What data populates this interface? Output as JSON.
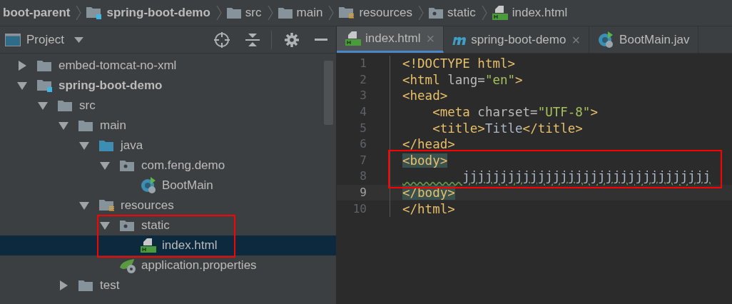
{
  "breadcrumbs": [
    {
      "label": "boot-parent",
      "kind": "plain",
      "bold": true
    },
    {
      "label": "spring-boot-demo",
      "kind": "module",
      "bold": true
    },
    {
      "label": "src",
      "kind": "folder",
      "bold": false
    },
    {
      "label": "main",
      "kind": "folder",
      "bold": false
    },
    {
      "label": "resources",
      "kind": "resources",
      "bold": false
    },
    {
      "label": "static",
      "kind": "package",
      "bold": false
    },
    {
      "label": "index.html",
      "kind": "html",
      "bold": false
    }
  ],
  "project_panel": {
    "title": "Project"
  },
  "tree": [
    {
      "label": "embed-tomcat-no-xml",
      "kind": "folder",
      "expanded": false,
      "selected": false,
      "bold": false
    },
    {
      "label": "spring-boot-demo",
      "kind": "module",
      "expanded": true,
      "selected": false,
      "bold": true,
      "children": [
        {
          "label": "src",
          "kind": "folder",
          "expanded": true,
          "selected": false,
          "bold": false,
          "children": [
            {
              "label": "main",
              "kind": "folder",
              "expanded": true,
              "selected": false,
              "bold": false,
              "children": [
                {
                  "label": "java",
                  "kind": "source",
                  "expanded": true,
                  "selected": false,
                  "bold": false,
                  "children": [
                    {
                      "label": "com.feng.demo",
                      "kind": "package",
                      "expanded": true,
                      "selected": false,
                      "bold": false,
                      "children": [
                        {
                          "label": "BootMain",
                          "kind": "boot",
                          "selected": false,
                          "bold": false
                        }
                      ]
                    }
                  ]
                },
                {
                  "label": "resources",
                  "kind": "resources",
                  "expanded": true,
                  "selected": false,
                  "bold": false,
                  "children": [
                    {
                      "label": "static",
                      "kind": "package",
                      "expanded": true,
                      "selected": false,
                      "bold": false,
                      "children": [
                        {
                          "label": "index.html",
                          "kind": "html",
                          "selected": true,
                          "bold": false
                        }
                      ]
                    },
                    {
                      "label": "application.properties",
                      "kind": "spring",
                      "selected": false,
                      "bold": false
                    }
                  ]
                }
              ]
            },
            {
              "label": "test",
              "kind": "folder",
              "expanded": false,
              "selected": false,
              "bold": false
            }
          ]
        }
      ]
    }
  ],
  "tabs": [
    {
      "label": "index.html",
      "kind": "html",
      "selected": true,
      "close": "×"
    },
    {
      "label": "spring-boot-demo",
      "kind": "maven",
      "selected": false,
      "close": "×"
    },
    {
      "label": "BootMain.jav",
      "kind": "boot",
      "selected": false
    }
  ],
  "editor": {
    "lines": [
      {
        "number": "1",
        "current": false,
        "segments": [
          {
            "kind": "tag",
            "text": "<!DOCTYPE html>"
          }
        ]
      },
      {
        "number": "2",
        "current": false,
        "segments": [
          {
            "kind": "tag",
            "text": "<html "
          },
          {
            "kind": "attr",
            "text": "lang="
          },
          {
            "kind": "string",
            "text": "\"en\""
          },
          {
            "kind": "tag",
            "text": ">"
          }
        ]
      },
      {
        "number": "3",
        "current": false,
        "segments": [
          {
            "kind": "tag",
            "text": "<head>"
          }
        ]
      },
      {
        "number": "4",
        "current": false,
        "segments": [
          {
            "kind": "tag",
            "text": "    <meta "
          },
          {
            "kind": "attr",
            "text": "charset="
          },
          {
            "kind": "string",
            "text": "\"UTF-8\""
          },
          {
            "kind": "tag",
            "text": ">"
          }
        ]
      },
      {
        "number": "5",
        "current": false,
        "segments": [
          {
            "kind": "tag",
            "text": "    <title>"
          },
          {
            "kind": "text",
            "text": "Title"
          },
          {
            "kind": "tag",
            "text": "</title>"
          }
        ]
      },
      {
        "number": "6",
        "current": false,
        "segments": [
          {
            "kind": "tag",
            "text": "</head>"
          }
        ]
      },
      {
        "number": "7",
        "current": false,
        "segments": [
          {
            "kind": "match",
            "text": "<body>"
          }
        ]
      },
      {
        "number": "8",
        "current": false,
        "segments": [
          {
            "kind": "typo",
            "text": "        jjjjjjjjjjjjjjjjjjjjjjjjjjjjjjjjj"
          }
        ]
      },
      {
        "number": "9",
        "current": true,
        "segments": [
          {
            "kind": "match",
            "text": "</body>"
          }
        ]
      },
      {
        "number": "10",
        "current": false,
        "segments": [
          {
            "kind": "tag",
            "text": "</html>"
          }
        ]
      }
    ]
  }
}
